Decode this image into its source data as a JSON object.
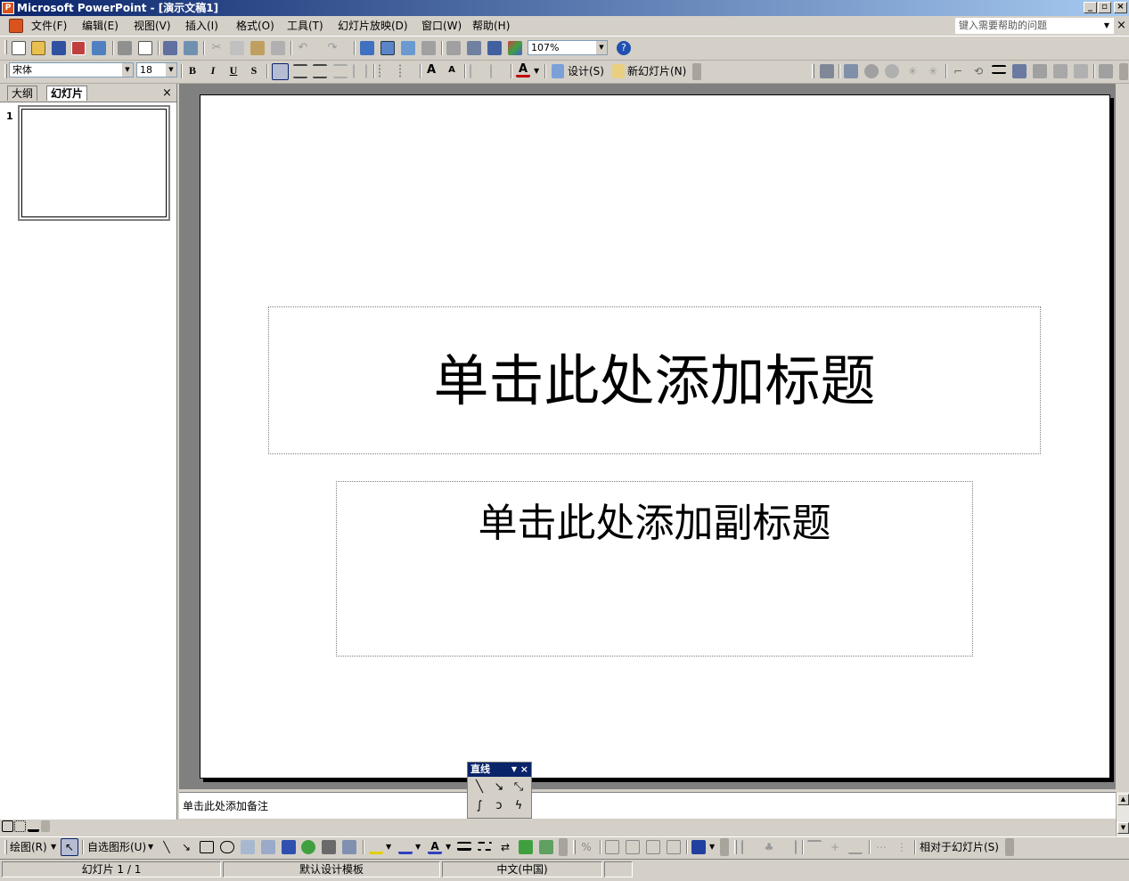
{
  "window": {
    "title": "Microsoft PowerPoint - [演示文稿1]",
    "app_icon": "powerpoint-icon",
    "controls": [
      "minimize-icon",
      "restore-icon",
      "close-icon"
    ]
  },
  "menubar": {
    "items": [
      {
        "label": "文件(F)"
      },
      {
        "label": "编辑(E)"
      },
      {
        "label": "视图(V)"
      },
      {
        "label": "插入(I)"
      },
      {
        "label": "格式(O)"
      },
      {
        "label": "工具(T)"
      },
      {
        "label": "幻灯片放映(D)"
      },
      {
        "label": "窗口(W)"
      },
      {
        "label": "帮助(H)"
      }
    ],
    "help_placeholder": "键入需要帮助的问题",
    "close_glyph": "×"
  },
  "standard_toolbar": {
    "zoom": "107%"
  },
  "formatting_toolbar": {
    "font_name": "宋体",
    "font_size": "18",
    "bold": "B",
    "italic": "I",
    "underline": "U",
    "shadow": "S",
    "design_label": "设计(S)",
    "new_slide_label": "新幻灯片(N)"
  },
  "left_pane": {
    "tabs": [
      {
        "label": "大纲",
        "active": false
      },
      {
        "label": "幻灯片",
        "active": true
      }
    ],
    "close_glyph": "×",
    "slide_number": "1"
  },
  "slide": {
    "title_placeholder": "单击此处添加标题",
    "subtitle_placeholder": "单击此处添加副标题"
  },
  "notes": {
    "placeholder": "单击此处添加备注"
  },
  "line_palette": {
    "title": "直线",
    "close_glyph": "×"
  },
  "drawing_toolbar": {
    "draw_label": "绘图(R)",
    "autoshapes_label": "自选图形(U)",
    "relative_label": "相对于幻灯片(S)"
  },
  "statusbar": {
    "slide_position": "幻灯片 1 / 1",
    "template": "默认设计模板",
    "language": "中文(中国)"
  },
  "colors": {
    "titlebar_start": "#0a246a",
    "titlebar_end": "#a6caf0",
    "chrome": "#d4d0c8",
    "workspace": "#808080"
  }
}
